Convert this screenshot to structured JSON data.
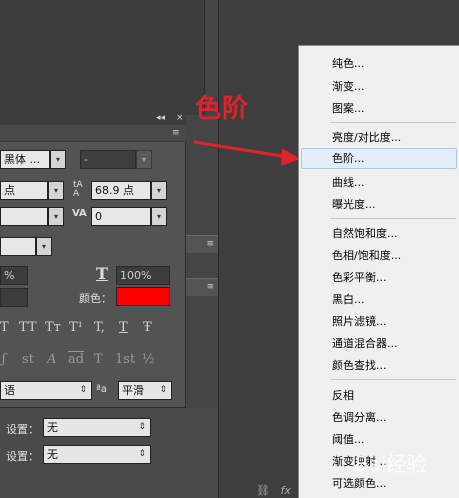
{
  "annotation": {
    "text": "色阶",
    "color": "#e2222a"
  },
  "character_panel": {
    "font_family": "黑体 ...",
    "font_style": "-",
    "font_size": "点",
    "leading": "68.9 点",
    "tracking": "0",
    "vertical_scale": "%",
    "horizontal_scale": "100%",
    "color_label": "颜色：",
    "color_value": "#ff0000",
    "style_glyphs": [
      "T",
      "TT",
      "Tт",
      "T¹",
      "T,",
      "T",
      "Ŧ"
    ],
    "opentype_glyphs": [
      "ʃ",
      "st",
      "A",
      "ad",
      "T",
      "1st",
      "½"
    ],
    "language": "语",
    "aa_label": "ªa",
    "antialias": "平滑"
  },
  "bottom_fields": [
    {
      "label": "设置：",
      "value": "无"
    },
    {
      "label": "设置：",
      "value": "无"
    }
  ],
  "menu": {
    "group1": [
      "纯色...",
      "渐变...",
      "图案..."
    ],
    "group2": [
      "亮度/对比度...",
      "色阶...",
      "曲线...",
      "曝光度..."
    ],
    "group3": [
      "自然饱和度...",
      "色相/饱和度...",
      "色彩平衡...",
      "黑白...",
      "照片滤镜...",
      "通道混合器...",
      "颜色查找..."
    ],
    "group4": [
      "反相",
      "色调分离...",
      "阈值...",
      "渐变映射...",
      "可选颜色..."
    ],
    "highlighted": "色阶..."
  },
  "watermark": "Bai经验"
}
